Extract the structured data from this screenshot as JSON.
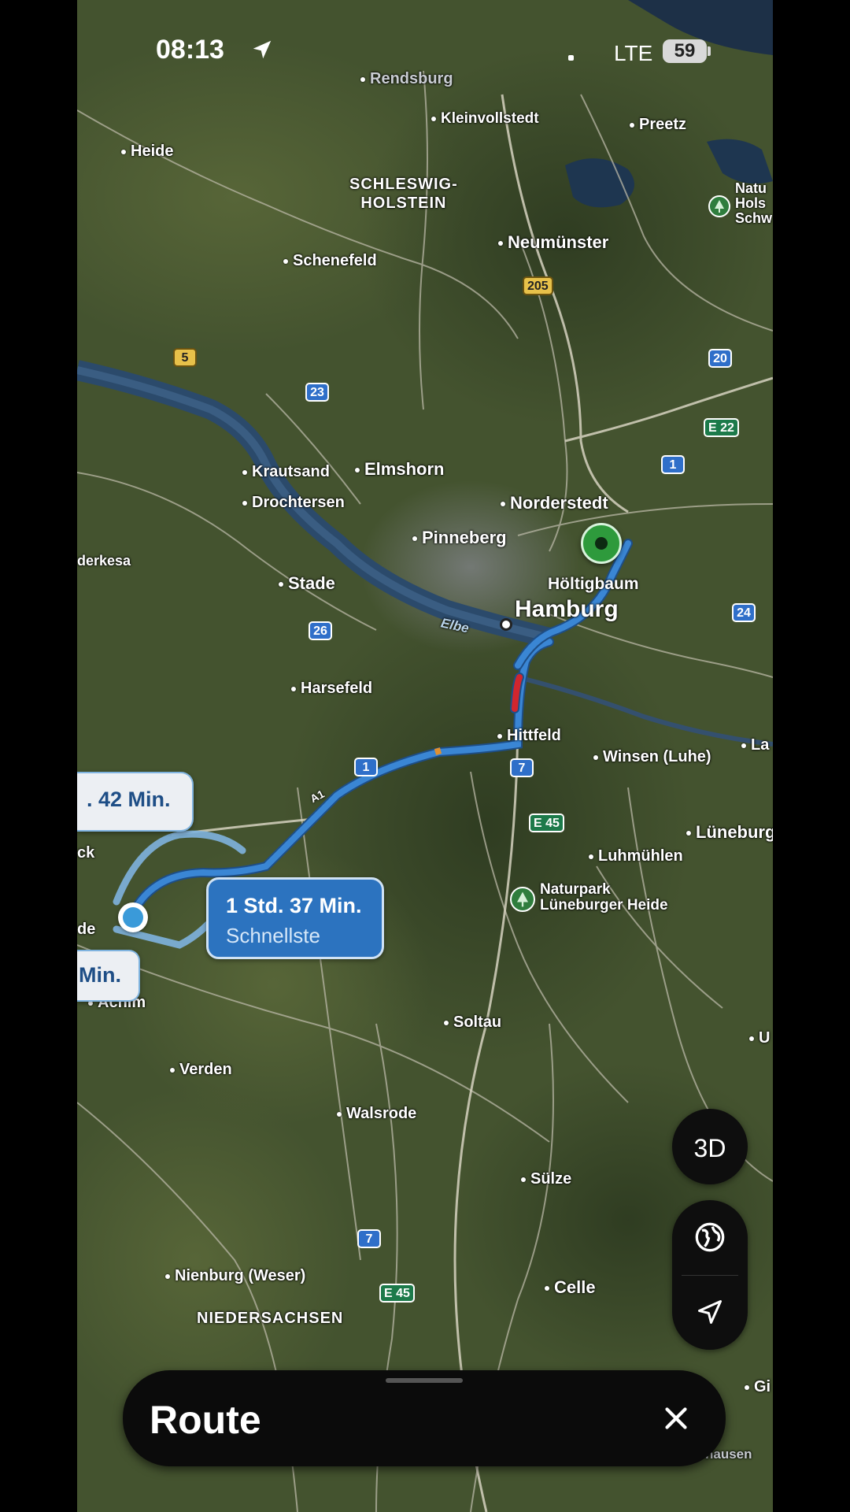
{
  "status_bar": {
    "time": "08:13",
    "network": "LTE",
    "battery": "59"
  },
  "map": {
    "places": [
      {
        "id": "rendsburg",
        "name": "Rendsburg"
      },
      {
        "id": "kleinvollstedt",
        "name": "Kleinvollstedt"
      },
      {
        "id": "preetz",
        "name": "Preetz"
      },
      {
        "id": "heide",
        "name": "Heide"
      },
      {
        "id": "neumuenster",
        "name": "Neumünster"
      },
      {
        "id": "schenefeld",
        "name": "Schenefeld"
      },
      {
        "id": "krautsand",
        "name": "Krautsand"
      },
      {
        "id": "elmshorn",
        "name": "Elmshorn"
      },
      {
        "id": "drochtersen",
        "name": "Drochtersen"
      },
      {
        "id": "norderstedt",
        "name": "Norderstedt"
      },
      {
        "id": "pinneberg",
        "name": "Pinneberg"
      },
      {
        "id": "derkesa",
        "name": "derkesa"
      },
      {
        "id": "stade",
        "name": "Stade"
      },
      {
        "id": "hoeltigbaum",
        "name": "Höltigbaum"
      },
      {
        "id": "hamburg",
        "name": "Hamburg"
      },
      {
        "id": "elbe",
        "name": "Elbe"
      },
      {
        "id": "harsefeld",
        "name": "Harsefeld"
      },
      {
        "id": "hittfeld",
        "name": "Hittfeld"
      },
      {
        "id": "winsen",
        "name": "Winsen (Luhe)"
      },
      {
        "id": "la",
        "name": "La"
      },
      {
        "id": "lueneburg",
        "name": "Lüneburg"
      },
      {
        "id": "luhmuehlen",
        "name": "Luhmühlen"
      },
      {
        "id": "ck",
        "name": "ck"
      },
      {
        "id": "de",
        "name": "de"
      },
      {
        "id": "achim",
        "name": "Achim"
      },
      {
        "id": "soltau",
        "name": "Soltau"
      },
      {
        "id": "u",
        "name": "U"
      },
      {
        "id": "verden",
        "name": "Verden"
      },
      {
        "id": "walsrode",
        "name": "Walsrode"
      },
      {
        "id": "suelze",
        "name": "Sülze"
      },
      {
        "id": "nienburg",
        "name": "Nienburg (Weser)"
      },
      {
        "id": "celle",
        "name": "Celle"
      },
      {
        "id": "gi",
        "name": "Gi"
      },
      {
        "id": "hausen",
        "name": "hausen"
      }
    ],
    "regions": [
      {
        "id": "schleswig",
        "name": "SCHLESWIG-\nHOLSTEIN"
      },
      {
        "id": "niedersachsen",
        "name": "NIEDERSACHSEN"
      }
    ],
    "parks": [
      {
        "id": "holst",
        "name": "Natu\nHols\nSchw"
      },
      {
        "id": "lueneburger",
        "name": "Naturpark\nLüneburger Heide"
      }
    ],
    "road_labels": [
      {
        "id": "a1",
        "name": "A1"
      }
    ],
    "shields": [
      {
        "id": "s205",
        "num": "205"
      },
      {
        "id": "s5",
        "num": "5"
      },
      {
        "id": "s20",
        "num": "20"
      },
      {
        "id": "s23",
        "num": "23"
      },
      {
        "id": "se22",
        "num": "E 22"
      },
      {
        "id": "s1a",
        "num": "1"
      },
      {
        "id": "s24",
        "num": "24"
      },
      {
        "id": "s26",
        "num": "26"
      },
      {
        "id": "s1b",
        "num": "1"
      },
      {
        "id": "s7a",
        "num": "7"
      },
      {
        "id": "se45a",
        "num": "E 45"
      },
      {
        "id": "s7b",
        "num": "7"
      },
      {
        "id": "se45b",
        "num": "E 45"
      }
    ]
  },
  "routes": {
    "alt1": ". 42 Min.",
    "fastest_time": "1 Std. 37 Min.",
    "fastest_label": "Schnellste",
    "alt2": "Min."
  },
  "controls": {
    "three_d": "3D",
    "globe_icon": "globe-icon",
    "location_icon": "location-arrow-icon"
  },
  "sheet": {
    "title": "Route",
    "close_icon": "close-icon"
  },
  "colors": {
    "route": "#3a86d4",
    "traffic": "#d0262e",
    "pin": "#2e9a3c"
  }
}
